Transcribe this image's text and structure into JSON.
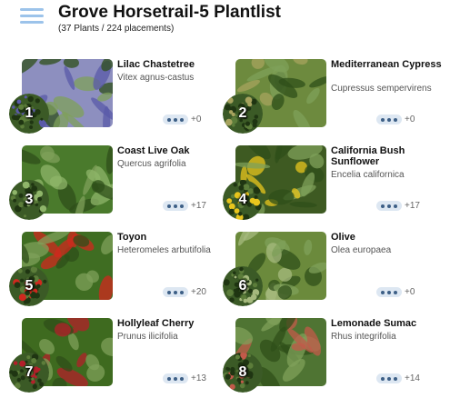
{
  "header": {
    "title": "Grove Horsetrail-5 Plantlist",
    "subtitle": "(37 Plants / 224 placements)"
  },
  "plants": [
    {
      "number": "1",
      "name": "Lilac Chastetree",
      "scientific": "Vitex agnus-castus",
      "count": "+0",
      "photo_color": "#8d8fbf",
      "accent_color": "#5a5aa8"
    },
    {
      "number": "2",
      "name": "Mediterranean Cypress",
      "scientific": "Cupressus sempervirens",
      "count": "+0",
      "photo_color": "#6d8a3e",
      "accent_color": "#a7a35e"
    },
    {
      "number": "3",
      "name": "Coast Live Oak",
      "scientific": "Quercus agrifolia",
      "count": "+17",
      "photo_color": "#4a7a2c",
      "accent_color": "#8fb56a"
    },
    {
      "number": "4",
      "name": "California Bush Sunflower",
      "scientific": "Encelia californica",
      "count": "+17",
      "photo_color": "#3e5a22",
      "accent_color": "#e8c51d"
    },
    {
      "number": "5",
      "name": "Toyon",
      "scientific": "Heteromeles arbutifolia",
      "count": "+20",
      "photo_color": "#3f6d22",
      "accent_color": "#d0281e"
    },
    {
      "number": "6",
      "name": "Olive",
      "scientific": "Olea europaea",
      "count": "+0",
      "photo_color": "#6b8a3c",
      "accent_color": "#a5b97d"
    },
    {
      "number": "7",
      "name": "Hollyleaf Cherry",
      "scientific": "Prunus ilicifolia",
      "count": "+13",
      "photo_color": "#3e6a1f",
      "accent_color": "#b3202a"
    },
    {
      "number": "8",
      "name": "Lemonade Sumac",
      "scientific": "Rhus integrifolia",
      "count": "+14",
      "photo_color": "#4f7433",
      "accent_color": "#c25a4a"
    }
  ]
}
